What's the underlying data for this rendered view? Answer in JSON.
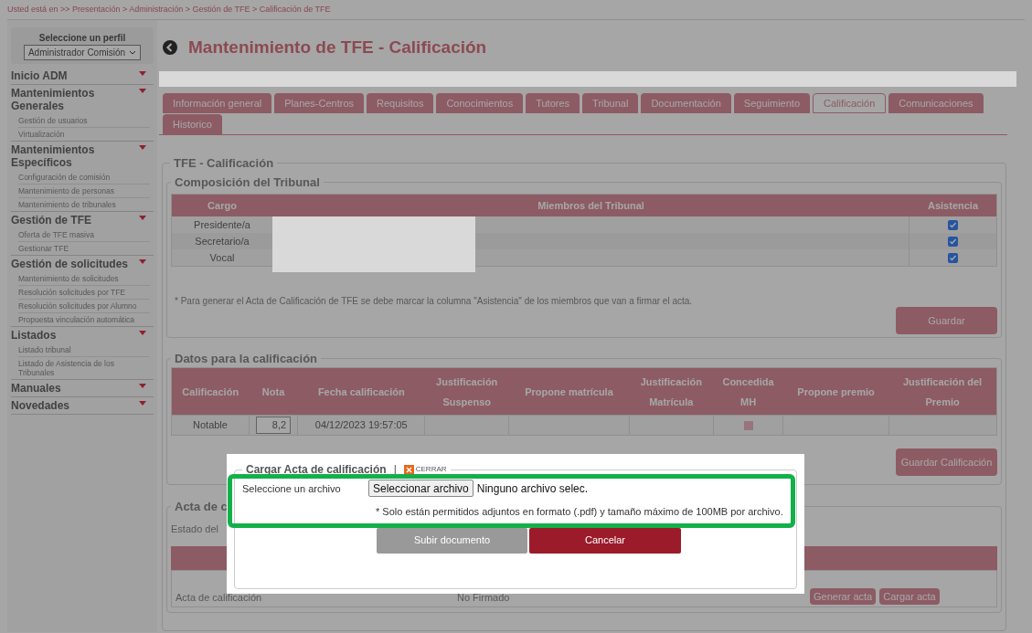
{
  "breadcrumb": "Usted está en >> Presentación > Administración > Gestión de TFE > Calificación de TFE",
  "sidebar": {
    "profile_label": "Seleccione un perfil",
    "profile_value": "Administrador Comisión",
    "menu": [
      {
        "title": "Inicio ADM"
      },
      {
        "title": "Mantenimientos Generales",
        "children": [
          "Gestión de usuarios",
          "Virtualización"
        ]
      },
      {
        "title": "Mantenimientos Específicos",
        "children": [
          "Configuración de comisión",
          "Mantenimiento de personas",
          "Mantenimiento de tribunales"
        ]
      },
      {
        "title": "Gestión de TFE",
        "children": [
          "Oferta de TFE masiva",
          "Gestionar TFE"
        ]
      },
      {
        "title": "Gestión de solicitudes",
        "children": [
          "Mantenimiento de solicitudes",
          "Resolución solicitudes por TFE",
          "Resolución solicitudes por Alumno",
          "Propuesta vinculación automática"
        ]
      },
      {
        "title": "Listados",
        "children": [
          "Listado tribunal",
          "Listado de Asistencia de los Tribunales"
        ]
      },
      {
        "title": "Manuales"
      },
      {
        "title": "Novedades"
      }
    ]
  },
  "title": "Mantenimiento de TFE - Calificación",
  "tabs": [
    {
      "label": "Información general",
      "selected": false
    },
    {
      "label": "Planes-Centros",
      "selected": false
    },
    {
      "label": "Requisitos",
      "selected": false
    },
    {
      "label": "Conocimientos",
      "selected": false
    },
    {
      "label": "Tutores",
      "selected": false
    },
    {
      "label": "Tribunal",
      "selected": false
    },
    {
      "label": "Documentación",
      "selected": false
    },
    {
      "label": "Seguimiento",
      "selected": false
    },
    {
      "label": "Calificación",
      "selected": true
    },
    {
      "label": "Comunicaciones",
      "selected": false
    },
    {
      "label": "Historico",
      "selected": false
    }
  ],
  "section_title": "TFE - Calificación",
  "tribunal": {
    "title": "Composición del Tribunal",
    "columns": [
      "Cargo",
      "Miembros del Tribunal",
      "Asistencia"
    ],
    "rows": [
      {
        "cargo": "Presidente/a",
        "asistencia": true
      },
      {
        "cargo": "Secretario/a",
        "asistencia": true
      },
      {
        "cargo": "Vocal",
        "asistencia": true
      }
    ],
    "note": "* Para generar el Acta de Calificación de TFE se debe marcar la columna \"Asistencia\" de los miembros que van a firmar el acta.",
    "button": "Guardar"
  },
  "datos": {
    "title": "Datos para la calificación",
    "columns": [
      [
        "Calificación"
      ],
      [
        "Nota"
      ],
      [
        "Fecha calificación"
      ],
      [
        "Justificación",
        "Suspenso"
      ],
      [
        "Propone matrícula"
      ],
      [
        "Justificación",
        "Matrícula"
      ],
      [
        "Concedida",
        "MH"
      ],
      [
        "Propone premio"
      ],
      [
        "Justificación del",
        "Premio"
      ]
    ],
    "row": {
      "calificacion": "Notable",
      "nota": "8,2",
      "fecha": "04/12/2023 19:57:05",
      "concedida_mh": false
    },
    "button": "Guardar Calificación"
  },
  "acta": {
    "title": "Acta de c",
    "estado": "Estado del",
    "row": {
      "name": "Acta de calificación",
      "status": "No Firmado"
    },
    "buttons": [
      "Generar acta",
      "Cargar acta"
    ]
  },
  "modal": {
    "title": "Cargar Acta de calificación",
    "separator": "|",
    "close": "CERRAR",
    "file_label": "Seleccione un archivo",
    "file_button": "Seleccionar archivo",
    "file_status": "Ninguno archivo selec.",
    "hint": "* Solo están permitidos adjuntos en formato (.pdf) y tamaño máximo de 100MB por archivo.",
    "upload": "Subir documento",
    "cancel": "Cancelar"
  }
}
